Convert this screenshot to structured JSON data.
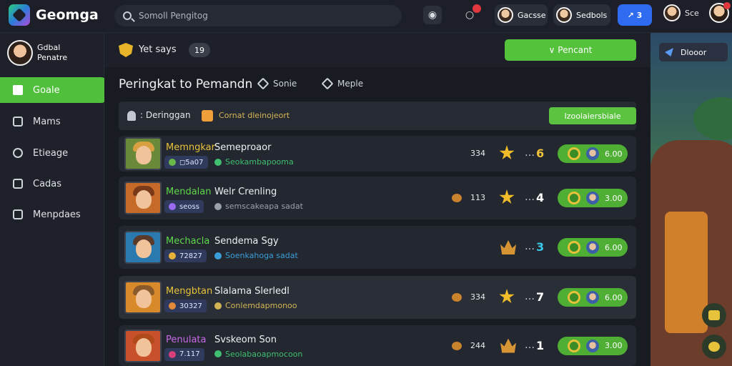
{
  "app": {
    "name": "Geomga"
  },
  "search": {
    "placeholder": "Somoll Pengitog"
  },
  "topbar": {
    "player1": "Gacsse",
    "player2": "Sedbols",
    "share_label": "↗ 3",
    "me_label": "Sce"
  },
  "user": {
    "line1": "Gdbal",
    "line2": "Penatre"
  },
  "sidebar": {
    "items": [
      {
        "label": "Goale",
        "active": true
      },
      {
        "label": "Mams",
        "active": false
      },
      {
        "label": "Etieage",
        "active": false
      },
      {
        "label": "Cadas",
        "active": false
      },
      {
        "label": "Menpdaes",
        "active": false
      }
    ]
  },
  "subhead": {
    "title": "Yet says",
    "count": "19",
    "cta": "∨ Pencant"
  },
  "page": {
    "title": "Peringkat to Pemandn",
    "tabs": [
      {
        "label": "Sonie"
      },
      {
        "label": "Meple"
      }
    ]
  },
  "filter": {
    "label": ": Deringgan",
    "tag": "Cornat dleinojeort",
    "button": "Izoolaiersbiale"
  },
  "rows": [
    {
      "name": "Memngkar",
      "name_color": "#e8c23a",
      "game": "Semeproaor",
      "chip": "◻5a07",
      "chip_dot": "#6ab84a",
      "sub": "Seokambapooma",
      "sub_color": "#3fbf6f",
      "score": "334",
      "show_coin": false,
      "icon": "star",
      "rank": "6",
      "rank_color": "#f0c23a",
      "reward": "6.00"
    },
    {
      "name": "Mendalan",
      "name_color": "#5ed84a",
      "game": "Welr Crenling",
      "chip": "seoss",
      "chip_dot": "#9a6af0",
      "sub": "semscakeapa sadat",
      "sub_color": "#9aa0aa",
      "score": "113",
      "show_coin": true,
      "icon": "star",
      "rank": "4",
      "rank_color": "#ffffff",
      "reward": "3.00"
    },
    {
      "name": "Mechacla",
      "name_color": "#5ed84a",
      "game": "Sendema Sgy",
      "chip": "72827",
      "chip_dot": "#e8b23a",
      "sub": "Soenkahoga sadat",
      "sub_color": "#3a9fd8",
      "score": "",
      "show_coin": false,
      "icon": "crown",
      "rank": "3",
      "rank_color": "#3ac8e8",
      "reward": "6.00"
    },
    {
      "name": "Mengbtan",
      "name_color": "#e8c23a",
      "game": "Slalama Slerledl",
      "chip": "30327",
      "chip_dot": "#e08a3a",
      "sub": "Conlemdapmonoo",
      "sub_color": "#d3b455",
      "score": "334",
      "show_coin": true,
      "icon": "star",
      "rank": "7",
      "rank_color": "#ffffff",
      "reward": "6.00"
    },
    {
      "name": "Penulata",
      "name_color": "#c86ae8",
      "game": "Svskeom Son",
      "chip": "7.117",
      "chip_dot": "#d8407a",
      "sub": "Seolabaoapmocoon",
      "sub_color": "#3fbf6f",
      "score": "244",
      "show_coin": true,
      "icon": "crown",
      "rank": "1",
      "rank_color": "#ffffff",
      "reward": "3.00"
    }
  ],
  "right": {
    "discord": "Dlooor"
  },
  "icons": [
    "search-icon",
    "camera-icon",
    "bell-icon",
    "shield-icon",
    "star-icon",
    "crown-icon",
    "coin-icon"
  ]
}
